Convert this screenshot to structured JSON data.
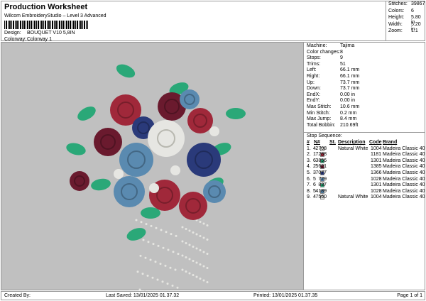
{
  "header": {
    "title": "Production Worksheet",
    "subtitle": "Wilcom EmbroideryStudio – Level 3 Advanced",
    "design_label": "Design:",
    "design": "BOUQUET V10 5,8IN",
    "colorway_label": "Colorway:",
    "colorway": "Colorway 1"
  },
  "stats": [
    {
      "k": "Stitches:",
      "v": "39867"
    },
    {
      "k": "Colors:",
      "v": "6"
    },
    {
      "k": "Height:",
      "v": "5.80 in"
    },
    {
      "k": "Width:",
      "v": "5.20 in"
    },
    {
      "k": "Zoom:",
      "v": "1:1"
    }
  ],
  "info": [
    {
      "k": "Machine:",
      "v": "Tajima"
    },
    {
      "k": "Color changes:",
      "v": "8"
    },
    {
      "k": "Stops:",
      "v": "9"
    },
    {
      "k": "Trims:",
      "v": "51"
    },
    {
      "k": "Left:",
      "v": "66.1 mm"
    },
    {
      "k": "Right:",
      "v": "66.1 mm"
    },
    {
      "k": "Up:",
      "v": "73.7 mm"
    },
    {
      "k": "Down:",
      "v": "73.7 mm"
    },
    {
      "k": "EndX:",
      "v": "0.00 in"
    },
    {
      "k": "EndY:",
      "v": "0.00 in"
    },
    {
      "k": "Max Stitch:",
      "v": "10.6 mm"
    },
    {
      "k": "Min Stitch:",
      "v": "0.2 mm"
    },
    {
      "k": "Max Jump:",
      "v": "8.4 mm"
    },
    {
      "k": "Total Bobbin:",
      "v": "210.69ft"
    }
  ],
  "sequence": {
    "title": "Stop Sequence:",
    "headers": {
      "num": "#",
      "n": "N#",
      "st": "St.",
      "desc": "Description",
      "code": "Code",
      "brand": "Brand"
    },
    "rows": [
      {
        "num": "1.",
        "n": "4",
        "color": "#e6e6e2",
        "st": "2708",
        "desc": "Natural White",
        "code": "1004",
        "brand": "Madeira Classic 40"
      },
      {
        "num": "2.",
        "n": "1",
        "color": "#a0283a",
        "st": "7288",
        "desc": "",
        "code": "1181",
        "brand": "Madeira Classic 40"
      },
      {
        "num": "3.",
        "n": "6",
        "color": "#2aa878",
        "st": "3856",
        "desc": "",
        "code": "1301",
        "brand": "Madeira Classic 40"
      },
      {
        "num": "4.",
        "n": "2",
        "color": "#6a1a2e",
        "st": "5621",
        "desc": "",
        "code": "1385",
        "brand": "Madeira Classic 40"
      },
      {
        "num": "5.",
        "n": "3",
        "color": "#2a3a7a",
        "st": "7077",
        "desc": "",
        "code": "1366",
        "brand": "Madeira Classic 40"
      },
      {
        "num": "6.",
        "n": "5",
        "color": "#5a8ab0",
        "st": "729",
        "desc": "",
        "code": "1028",
        "brand": "Madeira Classic 40"
      },
      {
        "num": "7.",
        "n": "6",
        "color": "#2aa878",
        "st": "837",
        "desc": "",
        "code": "1301",
        "brand": "Madeira Classic 40"
      },
      {
        "num": "8.",
        "n": "5",
        "color": "#5a8ab0",
        "st": "4189",
        "desc": "",
        "code": "1028",
        "brand": "Madeira Classic 40"
      },
      {
        "num": "9.",
        "n": "4",
        "color": "#e6e6e2",
        "st": "7560",
        "desc": "Natural White",
        "code": "1004",
        "brand": "Madeira Classic 40"
      }
    ]
  },
  "footer": {
    "created": "Created By:",
    "saved": "Last Saved: 13/01/2025 01.37.32",
    "printed": "Printed: 13/01/2025 01.37.35",
    "page": "Page 1 of 1"
  }
}
